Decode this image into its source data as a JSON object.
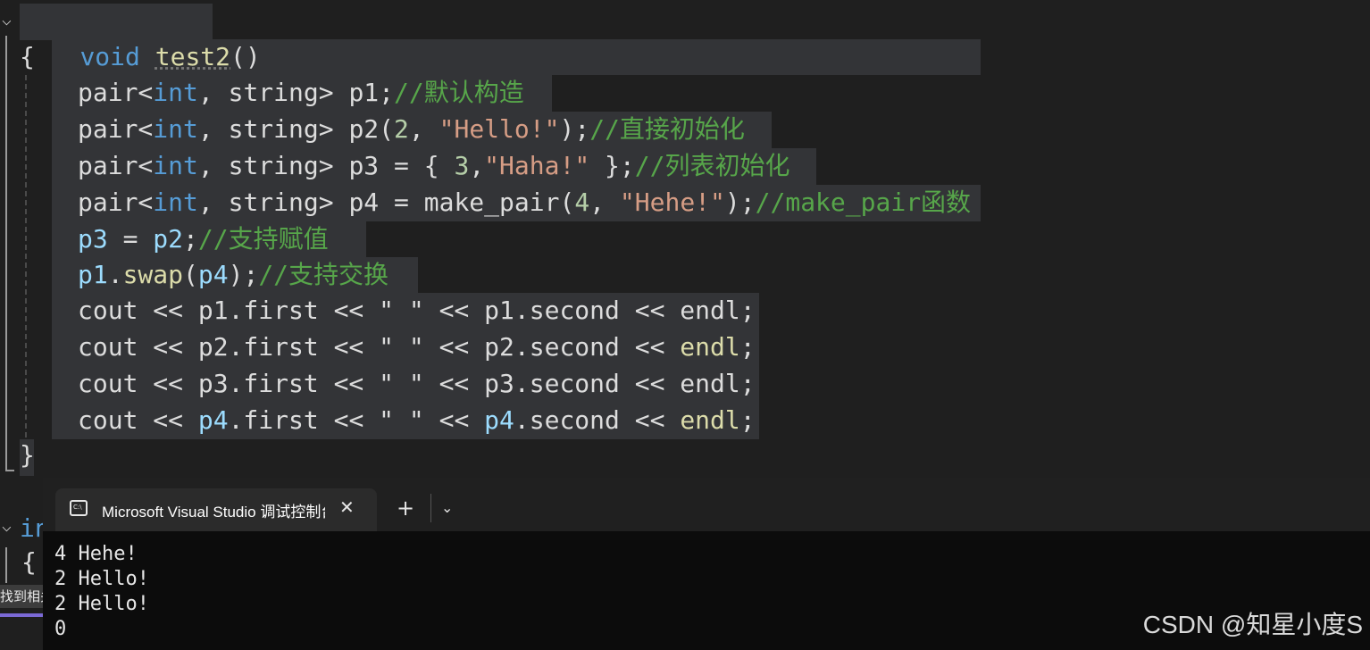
{
  "editor": {
    "line1": {
      "kw": "void",
      "fn": "test2",
      "rest": "()"
    },
    "line2": "{",
    "code": [
      [
        [
          "plain",
          "pair<"
        ],
        [
          "kw",
          "int"
        ],
        [
          "plain",
          ", string> p1;"
        ],
        [
          "cmt",
          "//默认构造"
        ]
      ],
      [
        [
          "plain",
          "pair<"
        ],
        [
          "kw",
          "int"
        ],
        [
          "plain",
          ", string> p2("
        ],
        [
          "num",
          "2"
        ],
        [
          "plain",
          ", "
        ],
        [
          "str",
          "\"Hello!\""
        ],
        [
          "plain",
          ");"
        ],
        [
          "cmt",
          "//直接初始化"
        ]
      ],
      [
        [
          "plain",
          "pair<"
        ],
        [
          "kw",
          "int"
        ],
        [
          "plain",
          ", string> p3 = { "
        ],
        [
          "num",
          "3"
        ],
        [
          "plain",
          ","
        ],
        [
          "str",
          "\"Haha!\""
        ],
        [
          "plain",
          " };"
        ],
        [
          "cmt",
          "//列表初始化"
        ]
      ],
      [
        [
          "plain",
          "pair<"
        ],
        [
          "kw",
          "int"
        ],
        [
          "plain",
          ", string> p4 = make_pair("
        ],
        [
          "num",
          "4"
        ],
        [
          "plain",
          ", "
        ],
        [
          "str",
          "\"Hehe!\""
        ],
        [
          "plain",
          ");"
        ],
        [
          "cmt",
          "//make_pair函数"
        ]
      ],
      [
        [
          "var",
          "p3"
        ],
        [
          "plain",
          " = "
        ],
        [
          "var",
          "p2"
        ],
        [
          "plain",
          ";"
        ],
        [
          "cmt",
          "//支持赋值"
        ]
      ],
      [
        [
          "var",
          "p1"
        ],
        [
          "plain",
          "."
        ],
        [
          "fn",
          "swap"
        ],
        [
          "plain",
          "("
        ],
        [
          "var",
          "p4"
        ],
        [
          "plain",
          ");"
        ],
        [
          "cmt",
          "//支持交换"
        ]
      ],
      [
        [
          "plain",
          "cout << p1.first << \" \" << p1.second << endl;"
        ]
      ],
      [
        [
          "plain",
          "cout << p2.first << \" \" << p2.second << "
        ],
        [
          "fn",
          "endl"
        ],
        [
          "plain",
          ";"
        ]
      ],
      [
        [
          "plain",
          "cout << p3.first << \" \" << p3.second << endl;"
        ]
      ],
      [
        [
          "plain",
          "cout << "
        ],
        [
          "var",
          "p4"
        ],
        [
          "plain",
          ".first << \" \" << "
        ],
        [
          "var",
          "p4"
        ],
        [
          "plain",
          ".second << "
        ],
        [
          "fn",
          "endl"
        ],
        [
          "plain",
          ";"
        ]
      ]
    ],
    "close": "}",
    "next_fn_start": "in",
    "next_brace": "{",
    "side_text": "找到相关"
  },
  "terminal": {
    "tab_title": "Microsoft Visual Studio 调试控制台",
    "icon_text": "C:\\",
    "close_glyph": "✕",
    "plus_glyph": "+",
    "chevron_glyph": "⌄",
    "output": [
      "4 Hehe!",
      "2 Hello!",
      "2 Hello!",
      "0"
    ]
  },
  "watermark": "CSDN @知星小度S"
}
